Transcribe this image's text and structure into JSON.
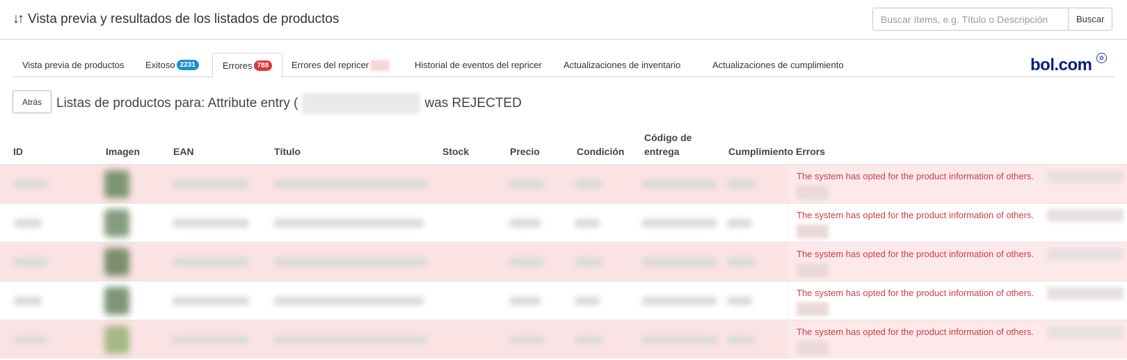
{
  "header": {
    "title": "Vista previa y resultados de los listados de productos",
    "sort_icon": "sort-arrows-icon",
    "search_placeholder": "Buscar ítems, e.g. Título o Descripción",
    "search_button": "Buscar"
  },
  "tabs": [
    {
      "label": "Vista previa de productos"
    },
    {
      "label": "Exitoso",
      "badge": "2231",
      "badge_color": "#1e8fd3"
    },
    {
      "label": "Errores",
      "badge": "788",
      "badge_color": "#d9363e"
    },
    {
      "label": "Errores del repricer"
    },
    {
      "label": "Historial de eventos del repricer"
    },
    {
      "label": "Actualizaciones de inventario"
    },
    {
      "label": "Actualizaciones de cumplimiento"
    }
  ],
  "logo": {
    "text": "bol.com"
  },
  "back_button": "Atrás",
  "listing": {
    "prefix": "Listas de productos para: Attribute entry (",
    "suffix": "was REJECTED"
  },
  "table": {
    "columns": [
      "ID",
      "Imagen",
      "EAN",
      "Título",
      "Stock",
      "Precio",
      "Condición",
      "Código de entrega",
      "Cumplimiento",
      "Errors"
    ],
    "error_message": "The system has opted for the product information of others.",
    "rows": [
      {
        "error": "The system has opted for the product information of others."
      },
      {
        "error": "The system has opted for the product information of others."
      },
      {
        "error": "The system has opted for the product information of others."
      },
      {
        "error": "The system has opted for the product information of others."
      },
      {
        "error": "The system has opted for the product information of others."
      }
    ]
  },
  "colors": {
    "accent_blue": "#1e8fd3",
    "error_red": "#d33b44",
    "row_highlight": "#fbe3e4",
    "logo_blue": "#0a1f78"
  }
}
